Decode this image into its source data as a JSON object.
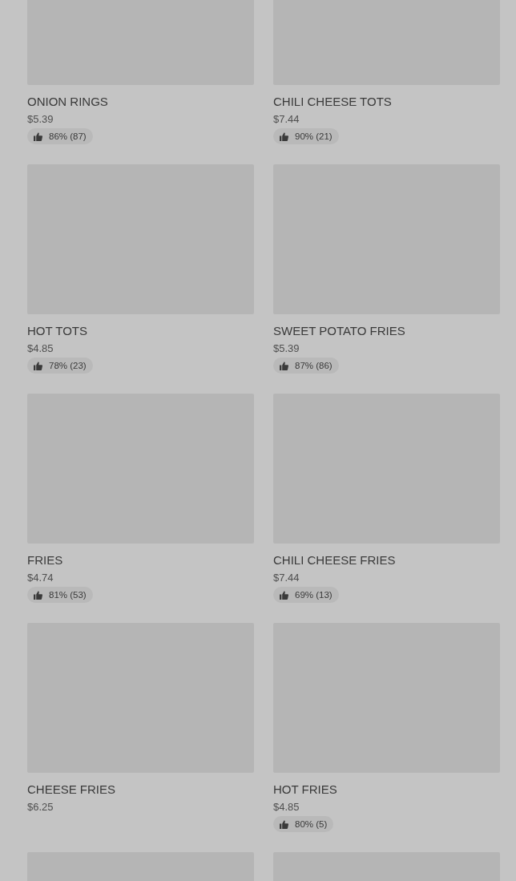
{
  "items": [
    {
      "kind": "dish",
      "name": "ONION RINGS",
      "price": "$5.39",
      "rating": "86% (87)"
    },
    {
      "kind": "dish",
      "name": "CHILI CHEESE TOTS",
      "price": "$7.44",
      "rating": "90% (21)"
    },
    {
      "kind": "dish",
      "name": "HOT TOTS",
      "price": "$4.85",
      "rating": "78% (23)"
    },
    {
      "kind": "dish",
      "name": "SWEET POTATO FRIES",
      "price": "$5.39",
      "rating": "87% (86)"
    },
    {
      "kind": "dish",
      "name": "FRIES",
      "price": "$4.74",
      "rating": "81% (53)"
    },
    {
      "kind": "dish",
      "name": "CHILI CHEESE FRIES",
      "price": "$7.44",
      "rating": "69% (13)"
    },
    {
      "kind": "dish",
      "name": "CHEESE FRIES",
      "price": "$6.25"
    },
    {
      "kind": "dish",
      "name": "HOT FRIES",
      "price": "$4.85",
      "rating": "80% (5)"
    },
    {
      "kind": "picture"
    },
    {
      "kind": "picture"
    }
  ]
}
